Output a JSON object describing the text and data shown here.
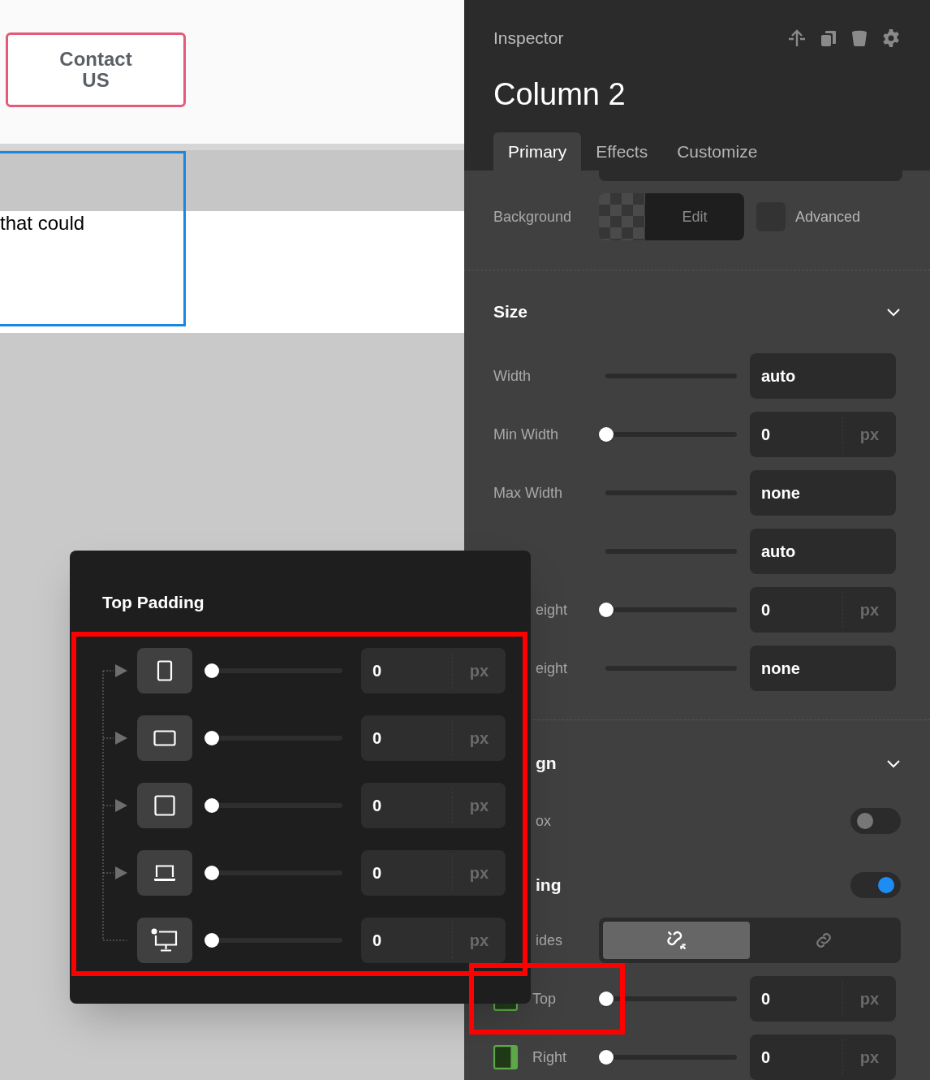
{
  "canvas": {
    "button": "Contact US",
    "text": "that could"
  },
  "popover": {
    "title": "Top Padding",
    "rows": [
      {
        "kind": "tablet",
        "level": 0,
        "value": "0",
        "unit": "px"
      },
      {
        "kind": "landscape",
        "level": 0,
        "value": "0",
        "unit": "px"
      },
      {
        "kind": "square",
        "level": 0,
        "value": "0",
        "unit": "px"
      },
      {
        "kind": "laptop",
        "level": 0,
        "value": "0",
        "unit": "px"
      },
      {
        "kind": "desktop",
        "level": 0,
        "value": "0",
        "unit": "px"
      }
    ]
  },
  "inspector": {
    "title": "Inspector",
    "heading": "Column 2",
    "tabs": [
      {
        "label": "Primary",
        "selected": true
      },
      {
        "label": "Effects",
        "selected": false
      },
      {
        "label": "Customize",
        "selected": false
      }
    ],
    "background": {
      "label": "Background",
      "button": "Edit",
      "advanced": {
        "label": "Advanced",
        "checked": false
      }
    },
    "sections": [
      {
        "title": "Size",
        "expanded": true,
        "rows": [
          {
            "kind": "text",
            "label": "Width",
            "value": "auto"
          },
          {
            "kind": "number",
            "label": "Min Width",
            "level": 0,
            "value": "0",
            "unit": "px"
          },
          {
            "kind": "text",
            "label": "Max Width",
            "value": "none"
          },
          {
            "kind": "text",
            "value": "auto"
          },
          {
            "kind": "number",
            "label": "eight",
            "covered": true,
            "level": 0,
            "value": "0",
            "unit": "px"
          },
          {
            "kind": "text",
            "label": "eight",
            "covered": true,
            "value": "none"
          }
        ]
      },
      {
        "title": "gn",
        "covered": true,
        "expanded": true,
        "rows": [
          {
            "kind": "toggle",
            "label": "ox",
            "covered": true,
            "on": false
          },
          {
            "kind": "toggle",
            "label": "ing",
            "covered": true,
            "strong": true,
            "on": true
          },
          {
            "kind": "segmented",
            "label": "ides",
            "covered": true,
            "options": [
              {
                "selected": true
              },
              {
                "selected": false
              }
            ]
          },
          {
            "kind": "topside",
            "label": "Top",
            "level": 0,
            "value": "0",
            "unit": "px"
          },
          {
            "kind": "rightside",
            "label": "Right",
            "level": 0,
            "value": "0",
            "unit": "px"
          }
        ]
      }
    ]
  }
}
